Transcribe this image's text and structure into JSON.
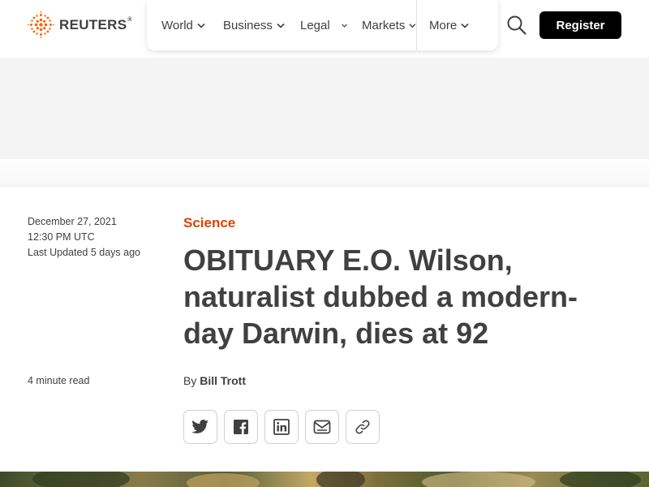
{
  "brand": {
    "name": "REUTERS",
    "mark": "®",
    "color": "#fa6400"
  },
  "nav": {
    "items": [
      {
        "label": "World"
      },
      {
        "label": "Business"
      },
      {
        "label": "Legal"
      },
      {
        "label": "Markets"
      },
      {
        "label": "More"
      }
    ]
  },
  "header": {
    "register_label": "Register",
    "search_icon": "search-icon"
  },
  "article": {
    "date": "December 27, 2021",
    "time": "12:30 PM UTC",
    "last_updated": "Last Updated 5 days ago",
    "read_time": "4 minute read",
    "category": "Science",
    "headline": "OBITUARY E.O. Wilson, naturalist dubbed a modern-day Darwin, dies at 92",
    "byline_prefix": "By",
    "author": "Bill Trott",
    "category_color": "#dc4300"
  },
  "share": {
    "buttons": [
      {
        "icon": "twitter-icon"
      },
      {
        "icon": "facebook-icon"
      },
      {
        "icon": "linkedin-icon"
      },
      {
        "icon": "email-icon"
      },
      {
        "icon": "link-icon"
      }
    ]
  }
}
